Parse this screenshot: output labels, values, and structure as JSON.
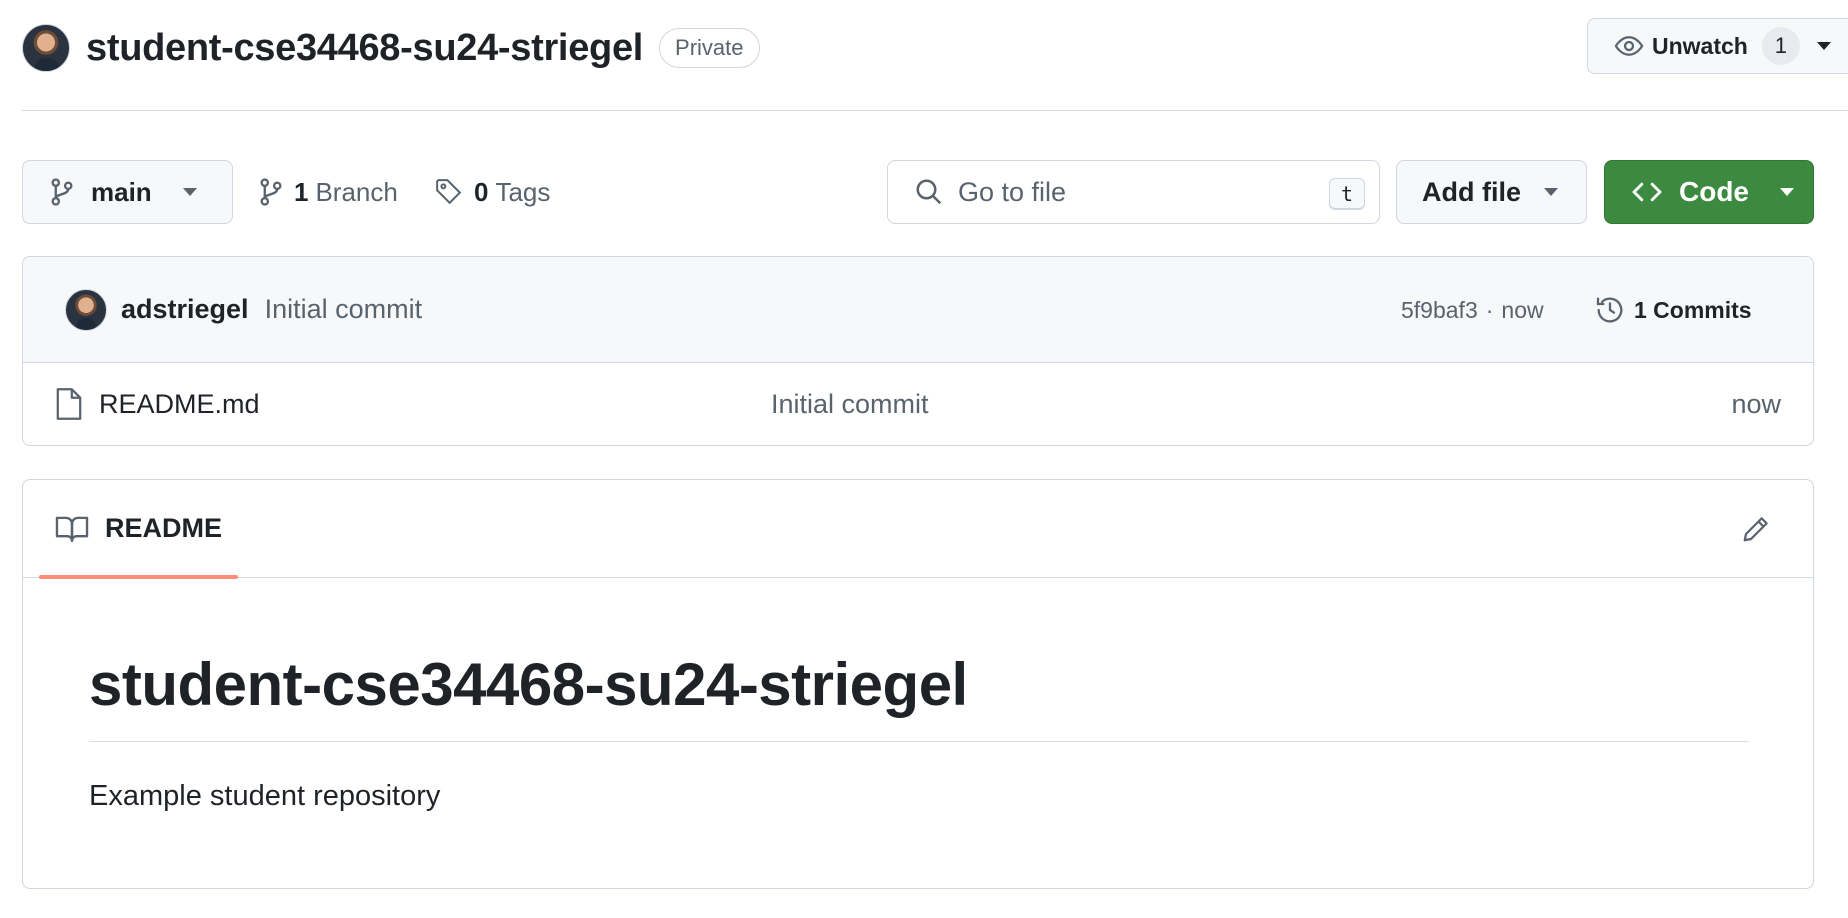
{
  "repo": {
    "name": "student-cse34468-su24-striegel",
    "visibility": "Private"
  },
  "watch": {
    "label": "Unwatch",
    "count": "1"
  },
  "toolbar": {
    "branch_name": "main",
    "branch_count": "1",
    "branch_label": "Branch",
    "tag_count": "0",
    "tag_label": "Tags",
    "search_placeholder": "Go to file",
    "search_shortcut": "t",
    "add_file_label": "Add file",
    "code_label": "Code"
  },
  "latest_commit": {
    "author": "adstriegel",
    "message": "Initial commit",
    "hash": "5f9baf3",
    "separator": "·",
    "time": "now",
    "commits_label": "1 Commits"
  },
  "files": [
    {
      "name": "README.md",
      "commit_message": "Initial commit",
      "time": "now"
    }
  ],
  "readme": {
    "tab_label": "README",
    "title": "student-cse34468-su24-striegel",
    "body": "Example student repository"
  },
  "colors": {
    "primary_button": "#3c8a40",
    "tab_underline": "#fd8c73",
    "border": "#d0d7de",
    "muted_text": "#59636e"
  },
  "icons": {
    "watch": "eye-icon",
    "branch": "git-branch-icon",
    "tag": "tag-icon",
    "search": "search-icon",
    "code": "code-icon",
    "history": "history-icon",
    "file": "file-icon",
    "readme": "book-icon",
    "edit": "pencil-icon",
    "dropdown": "triangle-down-icon"
  }
}
